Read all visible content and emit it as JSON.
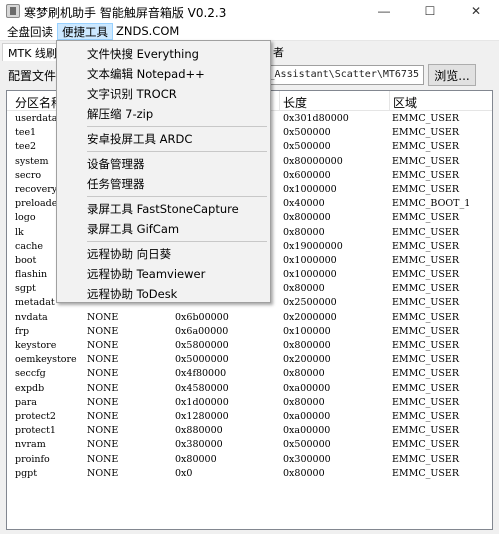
{
  "window": {
    "title": "寒梦刷机助手 智能触屏音箱版 V0.2.3",
    "minimize_glyph": "—",
    "maximize_glyph": "☐",
    "close_glyph": "✕"
  },
  "menubar": {
    "items": [
      "全盘回读",
      "便捷工具",
      "ZNDS.COM"
    ],
    "active": "便捷工具"
  },
  "tabs": {
    "first": "MTK 线刷",
    "last": "者"
  },
  "config": {
    "label": "配置文件:",
    "value": "rush_Assistant\\Scatter\\MT6735",
    "browse_label": "浏览..."
  },
  "table": {
    "headers": [
      "分区名称",
      "",
      "",
      "长度",
      "区域"
    ],
    "rows": [
      [
        "userdata",
        "",
        "",
        "0x301d80000",
        "EMMC_USER"
      ],
      [
        "tee1",
        "",
        "",
        "0x500000",
        "EMMC_USER"
      ],
      [
        "tee2",
        "",
        "",
        "0x500000",
        "EMMC_USER"
      ],
      [
        "system",
        "",
        "",
        "0x80000000",
        "EMMC_USER"
      ],
      [
        "secro",
        "",
        "",
        "0x600000",
        "EMMC_USER"
      ],
      [
        "recovery",
        "",
        "",
        "0x1000000",
        "EMMC_USER"
      ],
      [
        "preloade",
        "",
        "",
        "0x40000",
        "EMMC_BOOT_1"
      ],
      [
        "logo",
        "",
        "",
        "0x800000",
        "EMMC_USER"
      ],
      [
        "lk",
        "",
        "",
        "0x80000",
        "EMMC_USER"
      ],
      [
        "cache",
        "",
        "",
        "0x19000000",
        "EMMC_USER"
      ],
      [
        "boot",
        "",
        "",
        "0x1000000",
        "EMMC_USER"
      ],
      [
        "flashin",
        "",
        "",
        "0x1000000",
        "EMMC_USER"
      ],
      [
        "sgpt",
        "",
        "",
        "0x80000",
        "EMMC_USER"
      ],
      [
        "metadat",
        "",
        "",
        "0x2500000",
        "EMMC_USER"
      ],
      [
        "nvdata",
        "NONE",
        "0x6b00000",
        "0x2000000",
        "EMMC_USER"
      ],
      [
        "frp",
        "NONE",
        "0x6a00000",
        "0x100000",
        "EMMC_USER"
      ],
      [
        "keystore",
        "NONE",
        "0x5800000",
        "0x800000",
        "EMMC_USER"
      ],
      [
        "oemkeystore",
        "NONE",
        "0x5000000",
        "0x200000",
        "EMMC_USER"
      ],
      [
        "seccfg",
        "NONE",
        "0x4f80000",
        "0x80000",
        "EMMC_USER"
      ],
      [
        "expdb",
        "NONE",
        "0x4580000",
        "0xa00000",
        "EMMC_USER"
      ],
      [
        "para",
        "NONE",
        "0x1d00000",
        "0x80000",
        "EMMC_USER"
      ],
      [
        "protect2",
        "NONE",
        "0x1280000",
        "0xa00000",
        "EMMC_USER"
      ],
      [
        "protect1",
        "NONE",
        "0x880000",
        "0xa00000",
        "EMMC_USER"
      ],
      [
        "nvram",
        "NONE",
        "0x380000",
        "0x500000",
        "EMMC_USER"
      ],
      [
        "proinfo",
        "NONE",
        "0x80000",
        "0x300000",
        "EMMC_USER"
      ],
      [
        "pgpt",
        "NONE",
        "0x0",
        "0x80000",
        "EMMC_USER"
      ]
    ]
  },
  "dropdown": {
    "groups": [
      [
        "文件快搜 Everything",
        "文本编辑 Notepad++",
        "文字识别 TROCR",
        "解压缩 7-zip"
      ],
      [
        "安卓投屏工具 ARDC"
      ],
      [
        "设备管理器",
        "任务管理器"
      ],
      [
        "录屏工具 FastStoneCapture",
        "录屏工具 GifCam"
      ],
      [
        "远程协助 向日葵",
        "远程协助 Teamviewer",
        "远程协助 ToDesk"
      ]
    ]
  }
}
